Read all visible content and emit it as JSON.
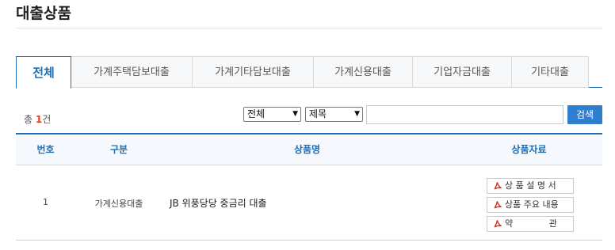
{
  "page": {
    "title": "대출상품"
  },
  "tabs": [
    {
      "label": "전체",
      "active": true
    },
    {
      "label": "가계주택담보대출",
      "active": false
    },
    {
      "label": "가계기타담보대출",
      "active": false
    },
    {
      "label": "가계신용대출",
      "active": false
    },
    {
      "label": "기업자금대출",
      "active": false
    },
    {
      "label": "기타대출",
      "active": false
    }
  ],
  "search": {
    "count_prefix": "총 ",
    "count_value": "1",
    "count_suffix": "건",
    "category_select": "전체",
    "field_select": "제목",
    "input_value": "",
    "button_label": "검색"
  },
  "table": {
    "headers": [
      "번호",
      "구분",
      "상품명",
      "상품자료"
    ],
    "rows": [
      {
        "number": "1",
        "category": "가계신용대출",
        "product_name": "JB 위풍당당 중금리 대출",
        "documents": [
          "상 품 설 명 서",
          "상품 주요 내용",
          "약             관"
        ]
      }
    ]
  },
  "colors": {
    "accent": "#1f6fb6",
    "search_button": "#2f7fd0",
    "count_highlight": "#e2401c",
    "pdf_icon": "#d9261c"
  },
  "icons": {
    "document": "pdf-icon"
  }
}
